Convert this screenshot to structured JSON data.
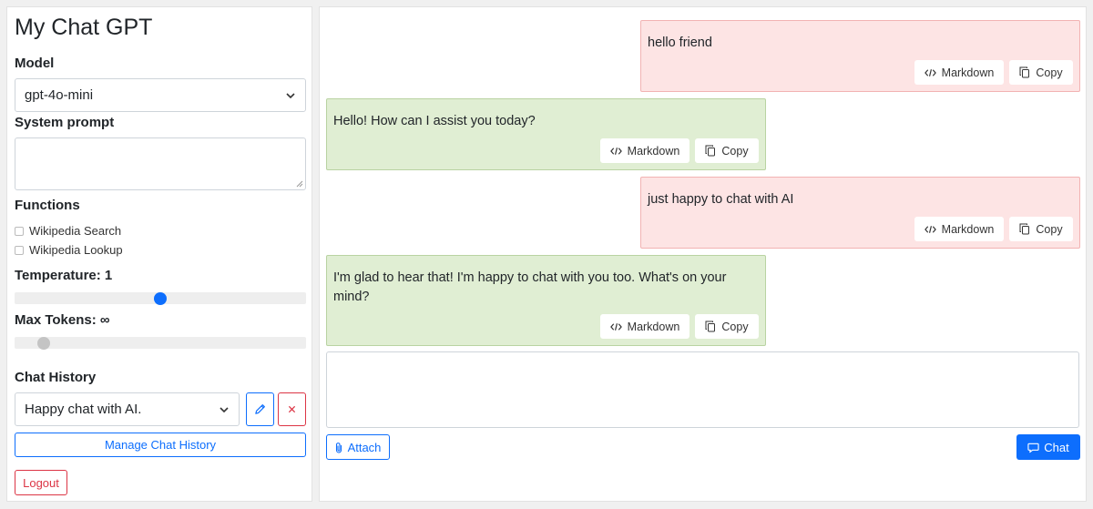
{
  "app": {
    "title": "My Chat GPT"
  },
  "colors": {
    "accent": "#0d6efd",
    "danger": "#dc3545",
    "user_bubble": "#fde4e4",
    "assistant_bubble": "#e0eed3"
  },
  "sidebar": {
    "model_label": "Model",
    "model_value": "gpt-4o-mini",
    "system_prompt_label": "System prompt",
    "system_prompt_value": "",
    "functions_label": "Functions",
    "functions": [
      {
        "label": "Wikipedia Search",
        "checked": false
      },
      {
        "label": "Wikipedia Lookup",
        "checked": false
      }
    ],
    "temperature_label": "Temperature: 1",
    "temperature_fraction": 0.5,
    "max_tokens_label": "Max Tokens: ∞",
    "max_tokens_fraction": 0.1,
    "chat_history_label": "Chat History",
    "chat_history_value": "Happy chat with AI.",
    "manage_history_label": "Manage Chat History",
    "logout_label": "Logout"
  },
  "messages": [
    {
      "role": "user",
      "text": "hello friend"
    },
    {
      "role": "assistant",
      "text": "Hello! How can I assist you today?"
    },
    {
      "role": "user",
      "text": "just happy to chat with AI"
    },
    {
      "role": "assistant",
      "text": "I'm glad to hear that! I'm happy to chat with you too. What's on your mind?"
    }
  ],
  "message_actions": {
    "markdown_label": "Markdown",
    "copy_label": "Copy"
  },
  "composer": {
    "input_value": "",
    "attach_label": "Attach",
    "chat_label": "Chat"
  },
  "icons": {
    "markdown": "code-icon",
    "copy": "copy-icon",
    "edit": "pencil-icon",
    "delete": "x-icon",
    "attach": "paperclip-icon",
    "chat": "chat-bubble-icon",
    "dropdown": "chevron-down-icon"
  }
}
